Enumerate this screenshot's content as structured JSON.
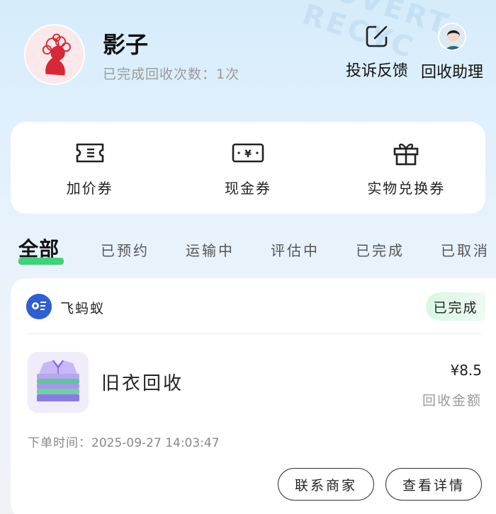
{
  "user": {
    "name": "影子",
    "completed_text": "已完成回收次数：1次"
  },
  "header_actions": {
    "complaint_label": "投诉反馈",
    "assistant_label": "回收助理"
  },
  "coupons": [
    {
      "label": "加价券",
      "icon": "ticket-icon"
    },
    {
      "label": "现金券",
      "icon": "cash-voucher-icon"
    },
    {
      "label": "实物兑换券",
      "icon": "gift-icon"
    }
  ],
  "tabs": [
    {
      "label": "全部",
      "active": true
    },
    {
      "label": "已预约"
    },
    {
      "label": "运输中"
    },
    {
      "label": "评估中"
    },
    {
      "label": "已完成"
    },
    {
      "label": "已取消"
    }
  ],
  "order": {
    "merchant": "飞蚂蚁",
    "status": "已完成",
    "product": "旧衣回收",
    "price": "¥8.5",
    "price_label": "回收金额",
    "time_label": "下单时间：",
    "time_value": "2025-09-27 14:03:47",
    "buttons": {
      "contact": "联系商家",
      "detail": "查看详情"
    }
  },
  "colors": {
    "accent_green": "#3fd27a",
    "merchant_blue": "#2f5fd1"
  }
}
